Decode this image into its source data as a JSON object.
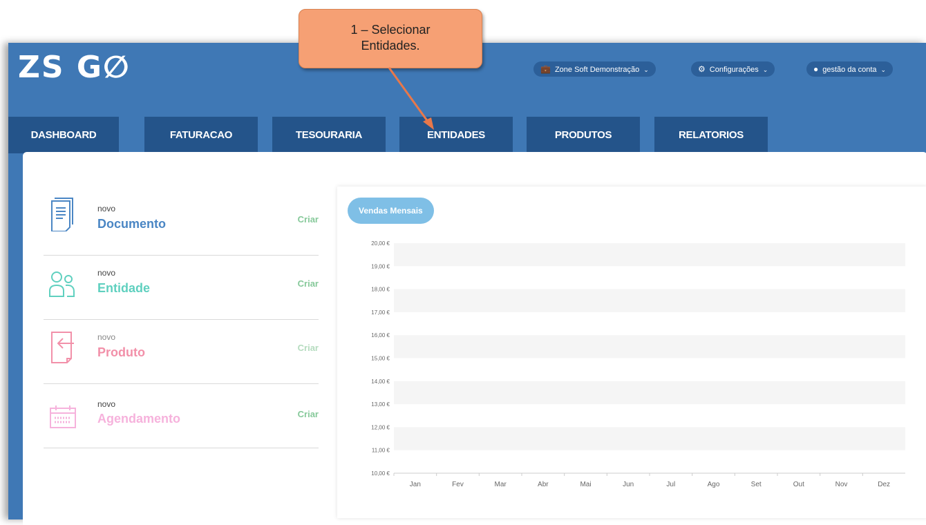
{
  "callout": {
    "line1": "1 – Selecionar",
    "line2": "Entidades."
  },
  "header": {
    "logo": "ZS G∅",
    "company_menu": "Zone Soft Demonstração",
    "settings_menu": "Configurações",
    "account_menu": "gestão da conta"
  },
  "tabs": [
    {
      "label": "DASHBOARD"
    },
    {
      "label": "FATURACAO"
    },
    {
      "label": "TESOURARIA"
    },
    {
      "label": "ENTIDADES"
    },
    {
      "label": "PRODUTOS"
    },
    {
      "label": "RELATORIOS"
    }
  ],
  "quick_actions": [
    {
      "small": "novo",
      "title": "Documento",
      "action": "Criar",
      "color": "#4a86c4",
      "icon": "document-icon"
    },
    {
      "small": "novo",
      "title": "Entidade",
      "action": "Criar",
      "color": "#5fd0bf",
      "icon": "people-icon"
    },
    {
      "small": "novo",
      "title": "Produto",
      "action": "Criar",
      "color": "#f290a9",
      "icon": "product-icon"
    },
    {
      "small": "novo",
      "title": "Agendamento",
      "action": "Criar",
      "color": "#f6b2dc",
      "icon": "calendar-icon"
    }
  ],
  "action_color": "#86c99a",
  "chart_data": {
    "type": "line",
    "title": "Vendas Mensais",
    "categories": [
      "Jan",
      "Fev",
      "Mar",
      "Abr",
      "Mai",
      "Jun",
      "Jul",
      "Ago",
      "Set",
      "Out",
      "Nov",
      "Dez"
    ],
    "ylim": [
      10,
      20
    ],
    "yticks": [
      "20,00 €",
      "19,00 €",
      "18,00 €",
      "17,00 €",
      "16,00 €",
      "15,00 €",
      "14,00 €",
      "13,00 €",
      "12,00 €",
      "11,00 €",
      "10,00 €"
    ],
    "series": []
  }
}
